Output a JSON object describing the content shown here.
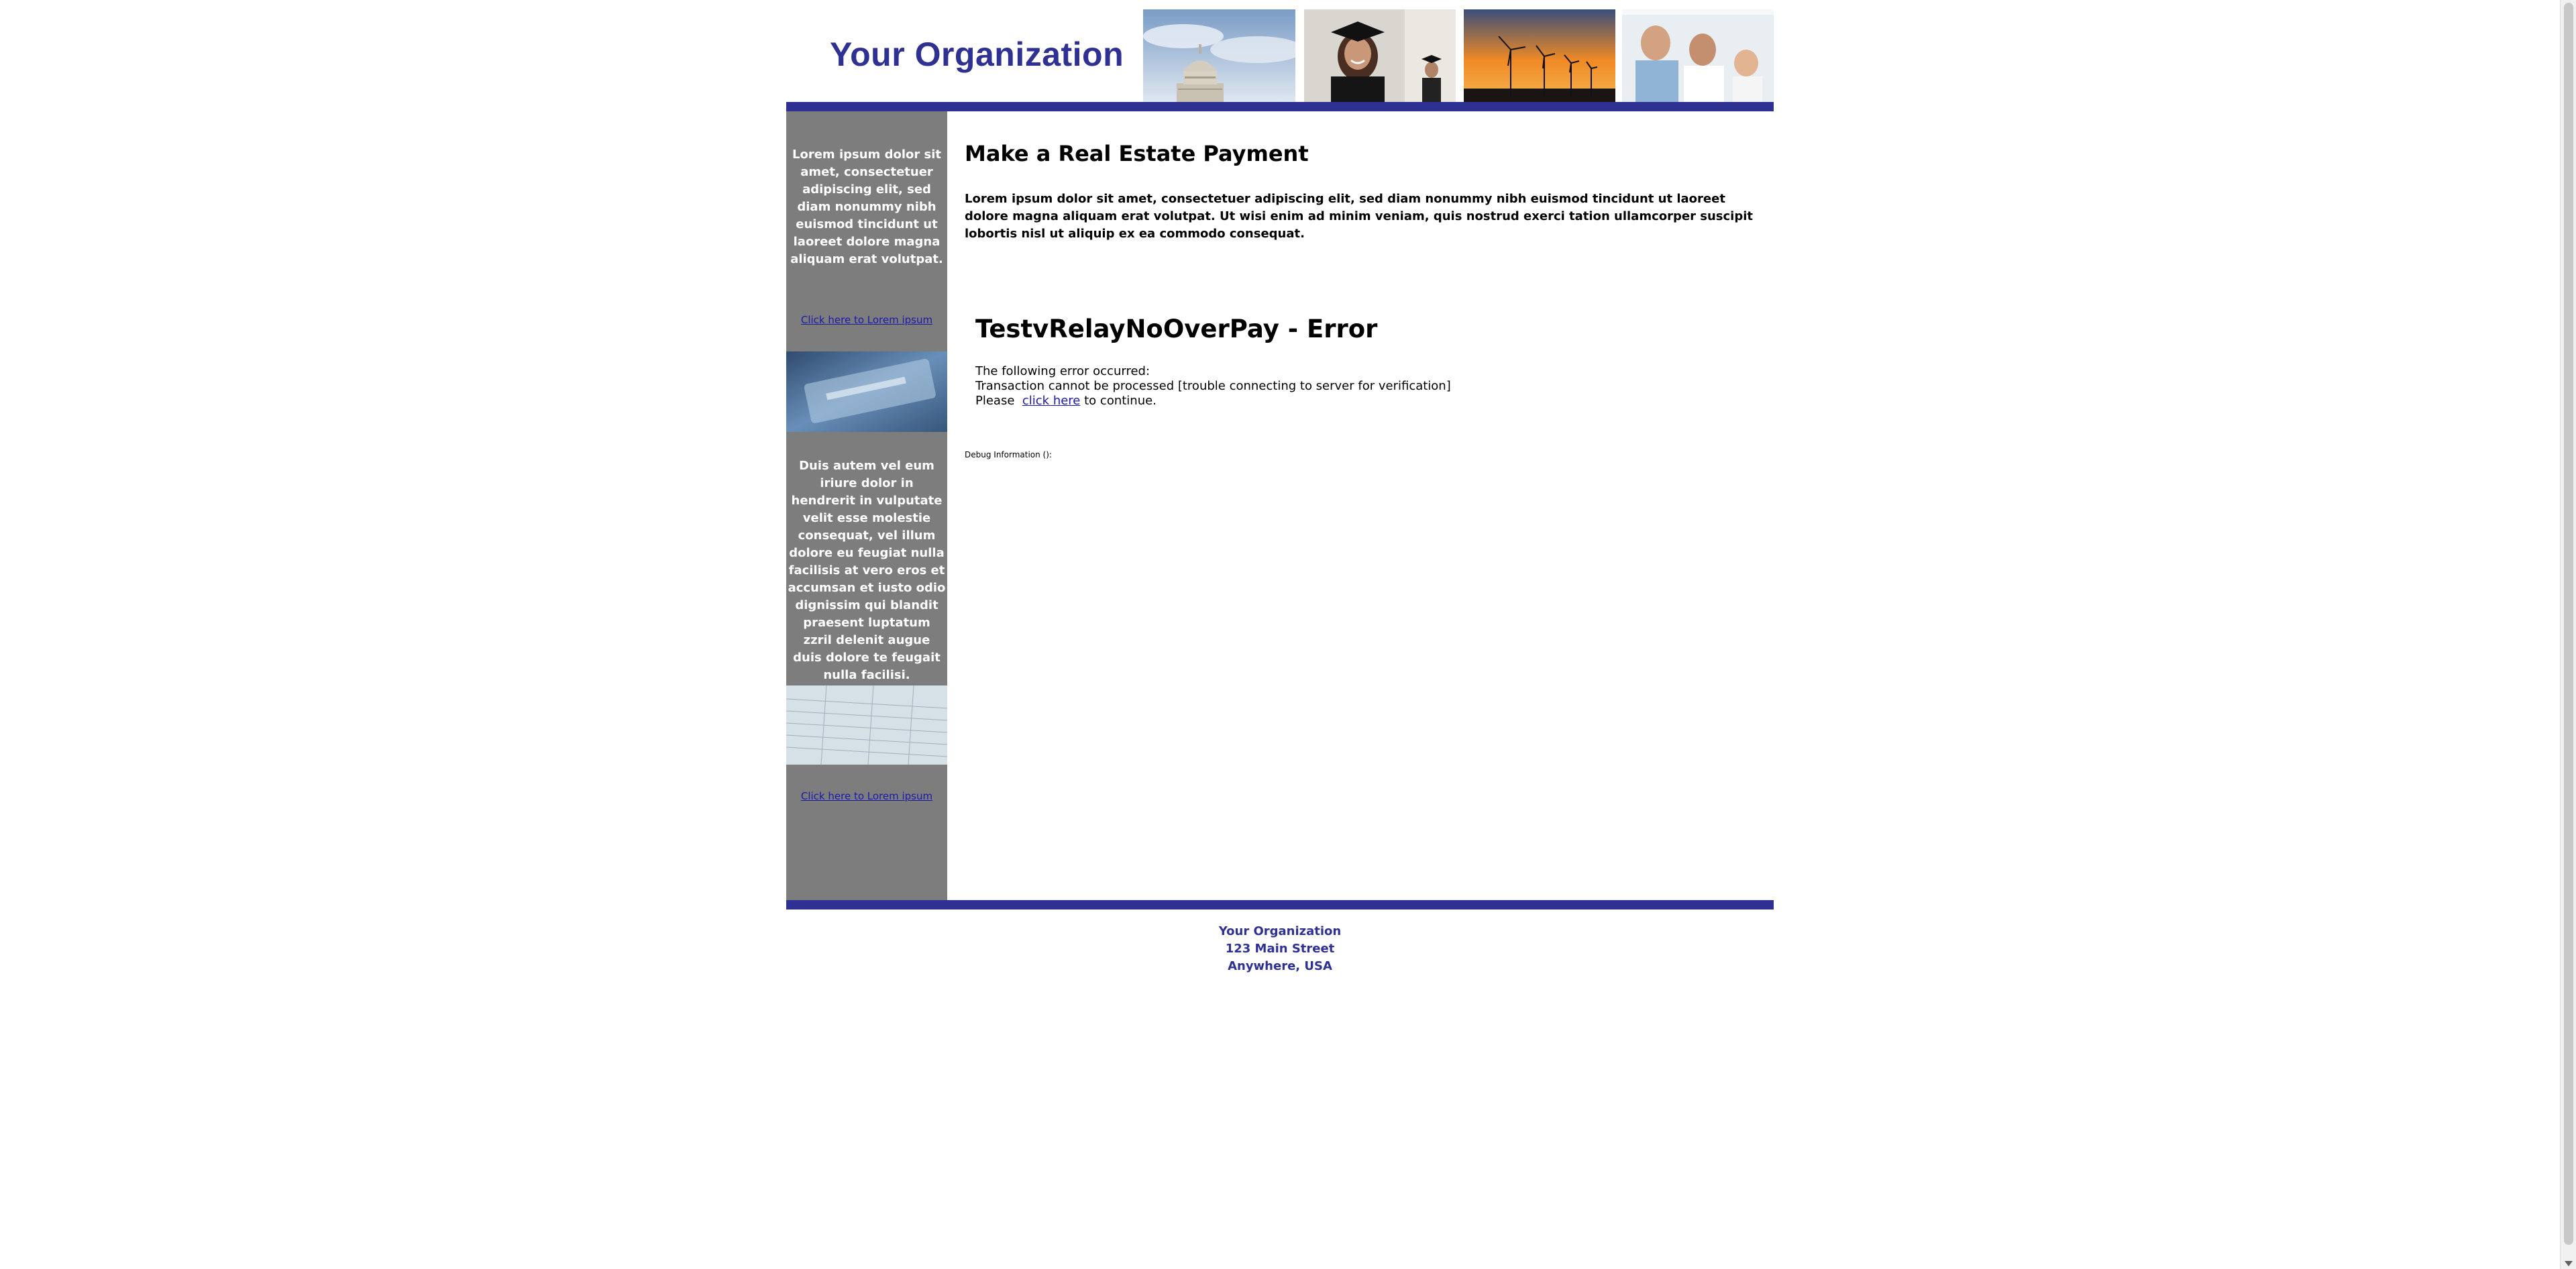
{
  "header": {
    "org_name": "Your Organization",
    "photos": [
      "capitol-photo",
      "graduate-photo",
      "wind-turbines-photo",
      "family-doctor-photo"
    ]
  },
  "sidebar": {
    "text_1": "Lorem ipsum dolor sit amet, consectetuer adipiscing elit, sed diam nonummy nibh euismod tincidunt ut laoreet dolore magna aliquam erat volutpat.",
    "link_1": "Click here to Lorem ipsum",
    "text_2": "Duis autem vel eum iriure dolor in hendrerit in vulputate velit esse molestie consequat, vel illum dolore eu feugiat nulla facilisis at vero eros et accumsan et iusto odio dignissim qui blandit praesent luptatum zzril delenit augue duis dolore te feugait nulla facilisi.",
    "link_2": "Click here to Lorem ipsum"
  },
  "main": {
    "title": "Make a Real Estate Payment",
    "intro": "Lorem ipsum dolor sit amet, consectetuer adipiscing elit, sed diam nonummy nibh euismod tincidunt ut laoreet dolore magna aliquam erat volutpat. Ut wisi enim ad minim veniam, quis nostrud exerci tation ullamcorper suscipit lobortis nisl ut aliquip ex ea commodo consequat.",
    "error_title": "TestvRelayNoOverPay - Error",
    "error_line_1": "The following error occurred:",
    "error_line_2": "Transaction cannot be processed [trouble connecting to server for verification]",
    "error_please": "Please",
    "error_link": "click here",
    "error_continue": "to continue.",
    "debug": "Debug Information ():"
  },
  "footer": {
    "line_1": "Your Organization",
    "line_2": "123 Main Street",
    "line_3": "Anywhere, USA"
  },
  "colors": {
    "brand_blue": "#2e3192",
    "sidebar_gray": "#7d7d7d",
    "link_blue": "#1a1aa6"
  }
}
